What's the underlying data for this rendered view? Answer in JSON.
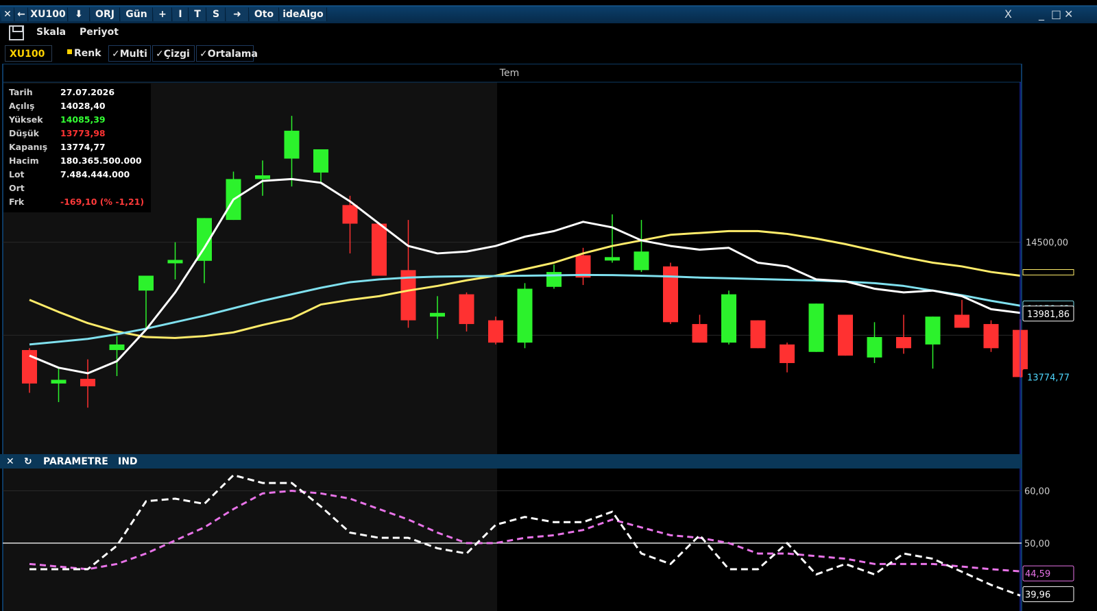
{
  "toolbar": {
    "close_label": "✕",
    "back_label": "←",
    "symbol": "XU100",
    "download_label": "⬇",
    "orj_label": "ORJ",
    "gun_label": "Gün",
    "plus_label": "+",
    "i_label": "I",
    "t_label": "T",
    "s_label": "S",
    "arrow_label": "➜",
    "oto_label": "Oto",
    "idealgo_label": "ideAlgo",
    "win_x_label": "X"
  },
  "menu": {
    "skala": "Skala",
    "periyot": "Periyot"
  },
  "options": {
    "symbol": "XU100",
    "renk": "Renk",
    "multi": "✓Multi",
    "cizgi": "✓Çizgi",
    "ortalama": "✓Ortalama"
  },
  "colors": {
    "up": "#2cf22c",
    "down": "#ff3131",
    "ma_white": "#ffffff",
    "ma_yellow": "#ffec6a",
    "ma_cyan": "#7fe0ee",
    "osc_white": "#ffffff",
    "osc_pink": "#e873e8"
  },
  "info": {
    "rows": [
      {
        "label": "Tarih",
        "value": "27.07.2026"
      },
      {
        "label": "Açılış",
        "value": "14028,40"
      },
      {
        "label": "Yüksek",
        "value": "14085,39"
      },
      {
        "label": "Düşük",
        "value": "13773,98"
      },
      {
        "label": "Kapanış",
        "value": "13774,77"
      },
      {
        "label": "Hacim",
        "value": "180.365.500.000"
      },
      {
        "label": "Lot",
        "value": "7.484.444.000"
      },
      {
        "label": "Ort",
        "value": ""
      },
      {
        "label": "Frk",
        "value": "-169,10 (% -1,21)"
      }
    ]
  },
  "param_bar": {
    "close": "✕",
    "refresh": "↻",
    "title": "PARAMETRE",
    "ind": "IND"
  },
  "chart_data": [
    {
      "type": "candlestick",
      "symbol": "XU100",
      "month_label": "Tem",
      "y_ticks": [
        "14500,00"
      ],
      "price_labels": {
        "cyan": "14158,63",
        "white": "13981,86",
        "last": "13774,77"
      },
      "ylim": [
        13360,
        15350
      ],
      "candles": [
        {
          "o": 13920,
          "h": 13930,
          "l": 13690,
          "c": 13740
        },
        {
          "o": 13740,
          "h": 13820,
          "l": 13640,
          "c": 13760
        },
        {
          "o": 13765,
          "h": 13870,
          "l": 13610,
          "c": 13725
        },
        {
          "o": 13920,
          "h": 13995,
          "l": 13780,
          "c": 13950
        },
        {
          "o": 14240,
          "h": 14300,
          "l": 14030,
          "c": 14320
        },
        {
          "o": 14400,
          "h": 14500,
          "l": 14300,
          "c": 14405
        },
        {
          "o": 14400,
          "h": 14590,
          "l": 14280,
          "c": 14630
        },
        {
          "o": 14620,
          "h": 14880,
          "l": 14620,
          "c": 14840
        },
        {
          "o": 14840,
          "h": 14940,
          "l": 14750,
          "c": 14860
        },
        {
          "o": 14950,
          "h": 15180,
          "l": 14800,
          "c": 15100
        },
        {
          "o": 14875,
          "h": 14960,
          "l": 14820,
          "c": 15000
        },
        {
          "o": 14700,
          "h": 14750,
          "l": 14440,
          "c": 14600
        },
        {
          "o": 14600,
          "h": 14560,
          "l": 14320,
          "c": 14320
        },
        {
          "o": 14350,
          "h": 14620,
          "l": 14040,
          "c": 14080
        },
        {
          "o": 14100,
          "h": 14210,
          "l": 13980,
          "c": 14120
        },
        {
          "o": 14220,
          "h": 14230,
          "l": 14020,
          "c": 14060
        },
        {
          "o": 14080,
          "h": 14100,
          "l": 13950,
          "c": 13960
        },
        {
          "o": 13960,
          "h": 14280,
          "l": 13930,
          "c": 14250
        },
        {
          "o": 14260,
          "h": 14380,
          "l": 14250,
          "c": 14340
        },
        {
          "o": 14430,
          "h": 14470,
          "l": 14270,
          "c": 14310
        },
        {
          "o": 14420,
          "h": 14650,
          "l": 14390,
          "c": 14420
        },
        {
          "o": 14350,
          "h": 14620,
          "l": 14340,
          "c": 14450
        },
        {
          "o": 14370,
          "h": 14390,
          "l": 14060,
          "c": 14070
        },
        {
          "o": 14060,
          "h": 14110,
          "l": 13970,
          "c": 13960
        },
        {
          "o": 13960,
          "h": 14240,
          "l": 13950,
          "c": 14220
        },
        {
          "o": 14080,
          "h": 14040,
          "l": 13930,
          "c": 13930
        },
        {
          "o": 13950,
          "h": 13960,
          "l": 13800,
          "c": 13850
        },
        {
          "o": 13910,
          "h": 14170,
          "l": 13910,
          "c": 14170
        },
        {
          "o": 14110,
          "h": 14110,
          "l": 13890,
          "c": 13890
        },
        {
          "o": 13880,
          "h": 14070,
          "l": 13850,
          "c": 13990
        },
        {
          "o": 13990,
          "h": 14110,
          "l": 13900,
          "c": 13930
        },
        {
          "o": 13950,
          "h": 14080,
          "l": 13820,
          "c": 14100
        },
        {
          "o": 14110,
          "h": 14190,
          "l": 14050,
          "c": 14040
        },
        {
          "o": 14060,
          "h": 14080,
          "l": 13910,
          "c": 13930
        },
        {
          "o": 14028.4,
          "h": 14085.39,
          "l": 13773.98,
          "c": 13774.77
        }
      ],
      "ma_white": [
        13890,
        13825,
        13795,
        13860,
        14030,
        14230,
        14470,
        14730,
        14830,
        14840,
        14820,
        14720,
        14600,
        14480,
        14440,
        14450,
        14480,
        14530,
        14560,
        14610,
        14580,
        14510,
        14480,
        14460,
        14470,
        14390,
        14370,
        14300,
        14290,
        14250,
        14230,
        14240,
        14210,
        14140,
        14120
      ],
      "ma_yellow": [
        14190,
        14125,
        14065,
        14020,
        13990,
        13985,
        13995,
        14015,
        14055,
        14090,
        14165,
        14190,
        14210,
        14240,
        14265,
        14295,
        14320,
        14355,
        14390,
        14440,
        14480,
        14510,
        14540,
        14550,
        14560,
        14560,
        14545,
        14520,
        14490,
        14455,
        14420,
        14390,
        14370,
        14340,
        14320
      ],
      "ma_cyan": [
        13950,
        13965,
        13980,
        14005,
        14035,
        14070,
        14105,
        14145,
        14185,
        14220,
        14255,
        14285,
        14300,
        14310,
        14315,
        14317,
        14318,
        14320,
        14322,
        14324,
        14323,
        14320,
        14316,
        14310,
        14306,
        14302,
        14298,
        14294,
        14288,
        14280,
        14265,
        14240,
        14215,
        14185,
        14158.63
      ]
    },
    {
      "type": "line",
      "y_ticks": [
        "60,00",
        "50,00"
      ],
      "value_labels": {
        "pink": "44,59",
        "white": "39,96"
      },
      "ylim": [
        37,
        64
      ],
      "series": [
        {
          "values": [
            45,
            45,
            45,
            49.5,
            58,
            58.5,
            57.5,
            63,
            61.5,
            61.5,
            57,
            52,
            51,
            51,
            49,
            48,
            53.5,
            55,
            54,
            54,
            56,
            48,
            46,
            51.5,
            45,
            45,
            50,
            44,
            46,
            44,
            48,
            47,
            44.5,
            42,
            39.96
          ]
        },
        {
          "values": [
            46,
            45.5,
            45,
            46,
            48,
            50.5,
            53,
            56.5,
            59.5,
            60,
            59.5,
            58.5,
            56.5,
            54.5,
            52,
            50,
            50,
            51,
            51.5,
            52.5,
            54.5,
            53,
            51.5,
            51,
            50,
            48,
            48,
            47.5,
            47,
            46,
            46,
            46,
            45.5,
            45,
            44.59
          ]
        }
      ],
      "hline": 50
    }
  ]
}
